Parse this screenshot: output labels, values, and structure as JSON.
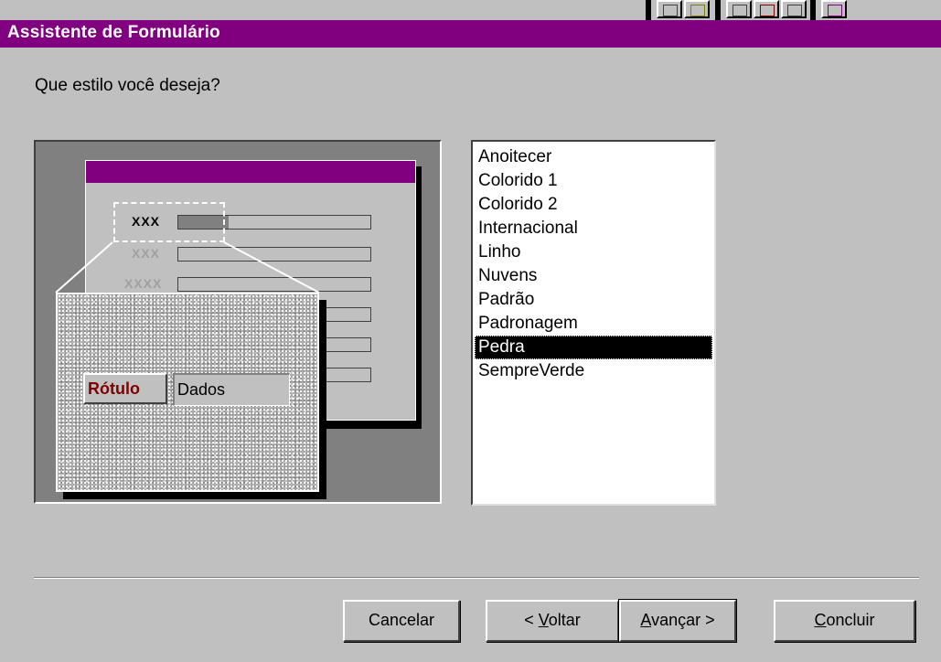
{
  "window": {
    "title": "Assistente de Formulário"
  },
  "prompt": "Que estilo você deseja?",
  "preview": {
    "labels": [
      "XXX",
      "XXX",
      "XXXX"
    ],
    "zoom_label": "Rótulo",
    "zoom_data": "Dados"
  },
  "styles": {
    "items": [
      "Anoitecer",
      "Colorido 1",
      "Colorido 2",
      "Internacional",
      "Linho",
      "Nuvens",
      "Padrão",
      "Padronagem",
      "Pedra",
      "SempreVerde"
    ],
    "selected": "Pedra"
  },
  "buttons": {
    "cancel": "Cancelar",
    "back_prefix": "< ",
    "back_key": "V",
    "back_rest": "oltar",
    "next_key": "A",
    "next_rest": "vançar >",
    "finish_key": "C",
    "finish_rest": "oncluir"
  },
  "colors": {
    "title_bar": "#800080",
    "dialog": "#c0c0c0",
    "zoom_label_text": "#800000"
  },
  "toolbar_icons": [
    "new-icon",
    "open-icon",
    "properties-icon",
    "form-icon",
    "picture-icon",
    "more-icon"
  ]
}
